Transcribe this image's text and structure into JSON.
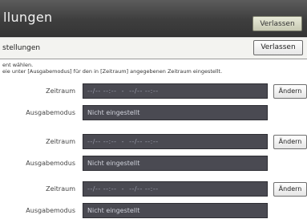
{
  "title_bar": {
    "title": "llungen",
    "exit_label": "Verlassen"
  },
  "sub_bar": {
    "title": "stellungen",
    "exit_label": "Verlassen"
  },
  "info": {
    "line1": "ent wählen.",
    "line2": "eie unter [Ausgabemodus] für den in [Zeitraum] angegebenen Zeitraum eingestellt."
  },
  "rows": [
    {
      "period_label": "Zeitraum",
      "period_value": "--/-- --:--  -  --/-- --:--",
      "change_label": "Ändern",
      "mode_label": "Ausgabemodus",
      "mode_value": "Nicht eingestellt"
    },
    {
      "period_label": "Zeitraum",
      "period_value": "--/-- --:--  -  --/-- --:--",
      "change_label": "Ändern",
      "mode_label": "Ausgabemodus",
      "mode_value": "Nicht eingestellt"
    },
    {
      "period_label": "Zeitraum",
      "period_value": "--/-- --:--  -  --/-- --:--",
      "change_label": "Ändern",
      "mode_label": "Ausgabemodus",
      "mode_value": "Nicht eingestellt"
    }
  ]
}
